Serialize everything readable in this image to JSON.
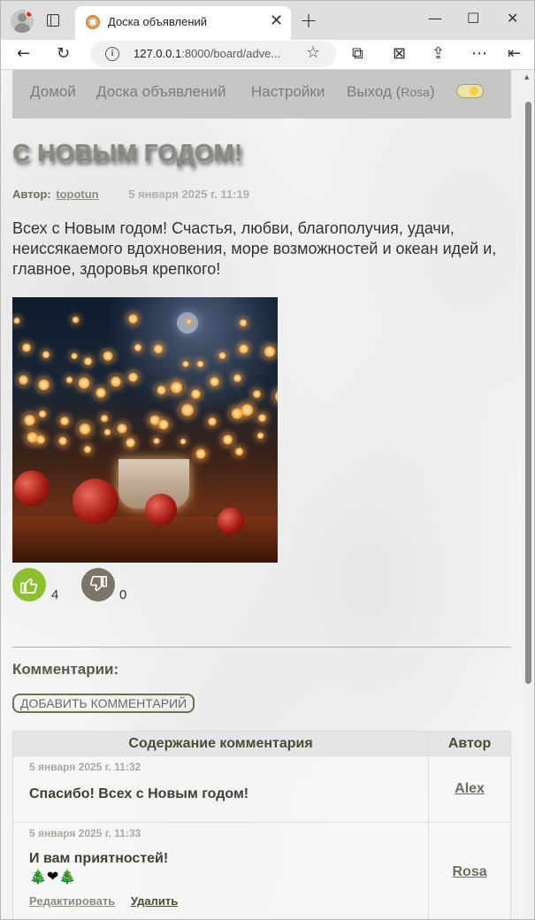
{
  "browser": {
    "tab_title": "Доска объявлений",
    "tab_close": "✕",
    "new_tab": "+",
    "minimize": "—",
    "maximize": "☐",
    "close": "✕",
    "url_host": "127.0.0.1",
    "url_rest": ":8000/board/adve..."
  },
  "nav": {
    "home": "Домой",
    "board": "Доска объявлений",
    "settings": "Настройки",
    "logout_prefix": "Выход (",
    "logout_user": "Rosa",
    "logout_suffix": ")"
  },
  "post": {
    "title": "С НОВЫМ ГОДОМ!",
    "author_label": "Автор:",
    "author": "topotun",
    "date": "5 января 2025 г. 11:19",
    "text": "Всех с Новым годом! Счастья, любви, благополучия, удачи, неиссякаемого вдохновения, море возможностей и океан идей и, главное, здоровья крепкого!",
    "likes": "4",
    "dislikes": "0"
  },
  "comments": {
    "heading": "Комментарии:",
    "add_button": "ДОБАВИТЬ КОММЕНТАРИЙ",
    "col_content": "Содержание комментария",
    "col_author": "Автор",
    "items": [
      {
        "date": "5 января 2025 г. 11:32",
        "text": "Спасибо! Всех с Новым годом!",
        "emoji": "",
        "author": "Alex"
      },
      {
        "date": "5 января 2025 г. 11:33",
        "text": "И вам приятностей!",
        "emoji": "🎄❤🎄",
        "author": "Rosa",
        "edit_label": "Редактировать",
        "delete_label": "Удалить"
      }
    ]
  },
  "colors": {
    "like": "#8bc12f",
    "dislike": "#7b7468",
    "navbar": "#c6c6c6"
  }
}
